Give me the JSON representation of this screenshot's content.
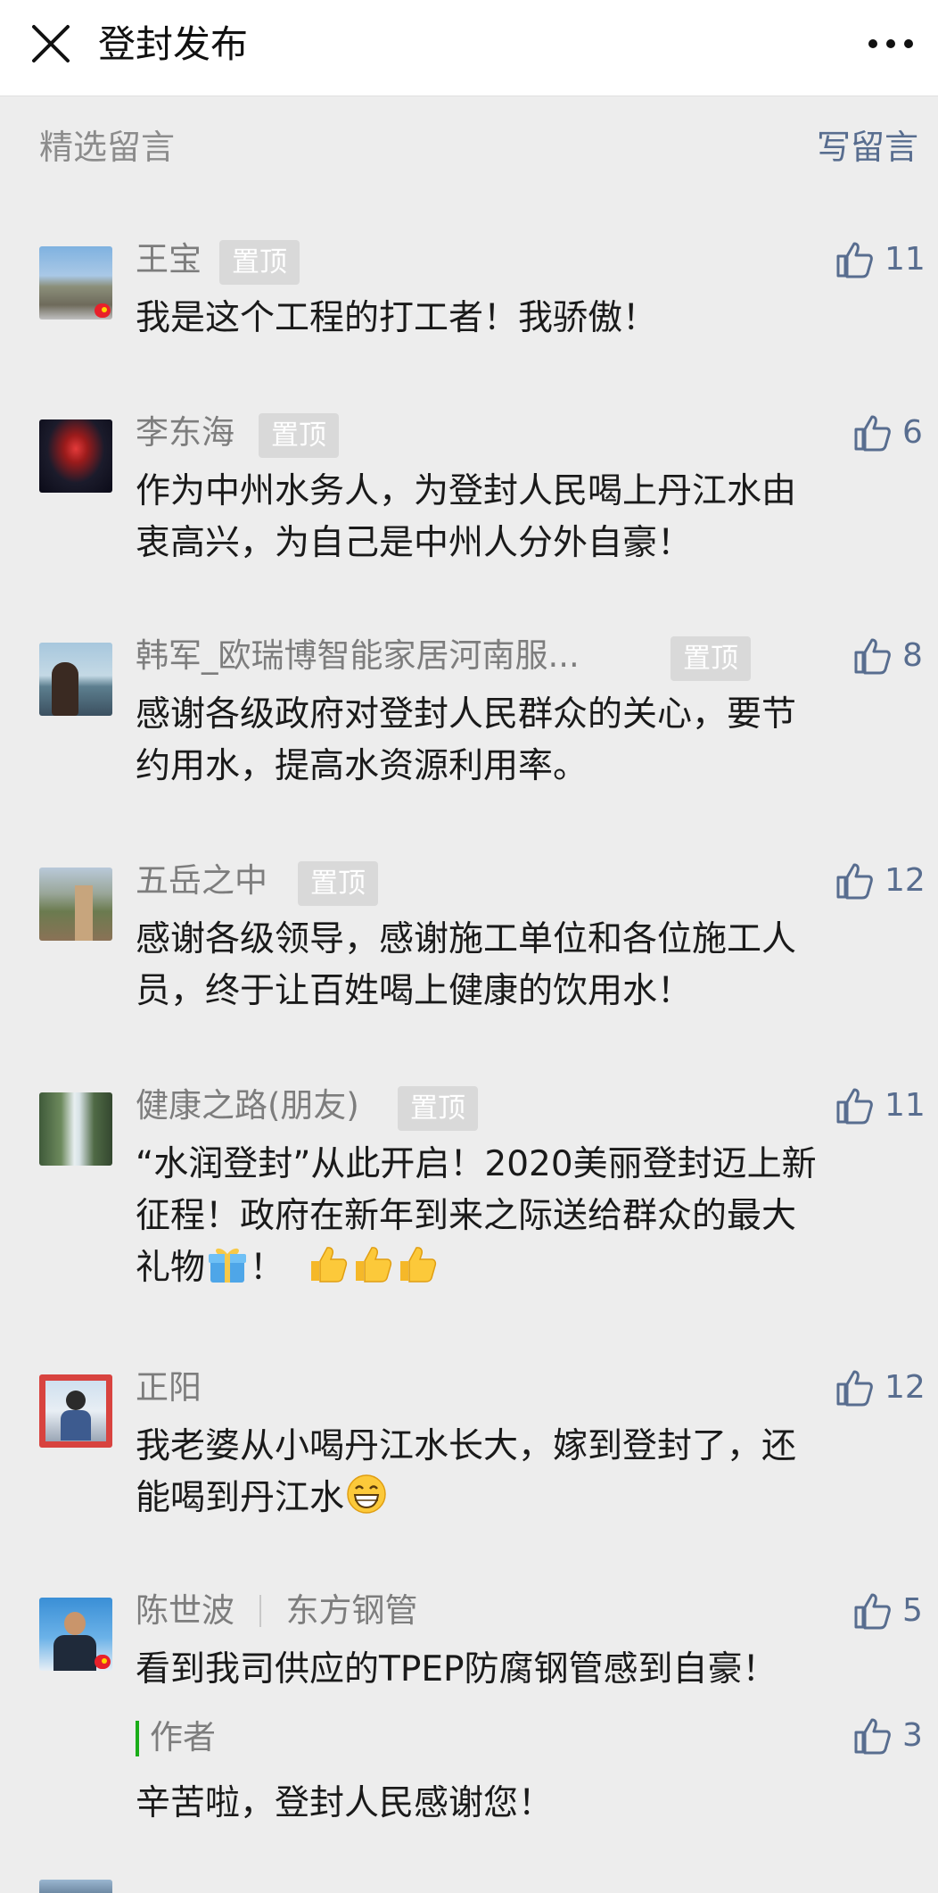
{
  "header": {
    "title": "登封发布"
  },
  "section": {
    "label": "精选留言",
    "write_label": "写留言",
    "pin_label": "置顶"
  },
  "comments": [
    {
      "name": "王宝",
      "likes": "11",
      "text": "我是这个工程的打工者！我骄傲！"
    },
    {
      "name": "李东海",
      "likes": "6",
      "text_lines": [
        "作为中州水务人，为登封人民喝上丹江水由",
        "衷高兴，为自己是中州人分外自豪！"
      ]
    },
    {
      "name": "韩军_欧瑞博智能家居河南服...",
      "likes": "8",
      "text_lines": [
        "感谢各级政府对登封人民群众的关心，要节",
        "约用水，提高水资源利用率。"
      ]
    },
    {
      "name": "五岳之中",
      "likes": "12",
      "text_lines": [
        "感谢各级领导，感谢施工单位和各位施工人",
        "员，终于让百姓喝上健康的饮用水！"
      ]
    },
    {
      "name": "健康之路(朋友)",
      "likes": "11",
      "text_lines": [
        "“水润登封”从此开启！2020美丽登封迈上新",
        "征程！政府在新年到来之际送给群众的最大",
        "礼物",
        "！"
      ]
    },
    {
      "name": "正阳",
      "likes": "12",
      "text_lines": [
        "我老婆从小喝丹江水长大，嫁到登封了，还",
        "能喝到丹江水"
      ]
    },
    {
      "name": "陈世波",
      "company": "东方钢管",
      "likes": "5",
      "text": "看到我司供应的TPEP防腐钢管感到自豪！",
      "reply": {
        "label": "作者",
        "likes": "3",
        "text": "辛苦啦，登封人民感谢您！"
      }
    }
  ],
  "icons": {
    "close": "close-icon",
    "more": "more-icon",
    "like": "thumbs-up-icon",
    "gift": "gift-emoji",
    "thumbs": "thumbs-up-emoji",
    "grin": "grinning-emoji"
  },
  "colors": {
    "link": "#586d8f",
    "author_bar": "#1aad19",
    "pin_bg": "#d9d9d9"
  }
}
